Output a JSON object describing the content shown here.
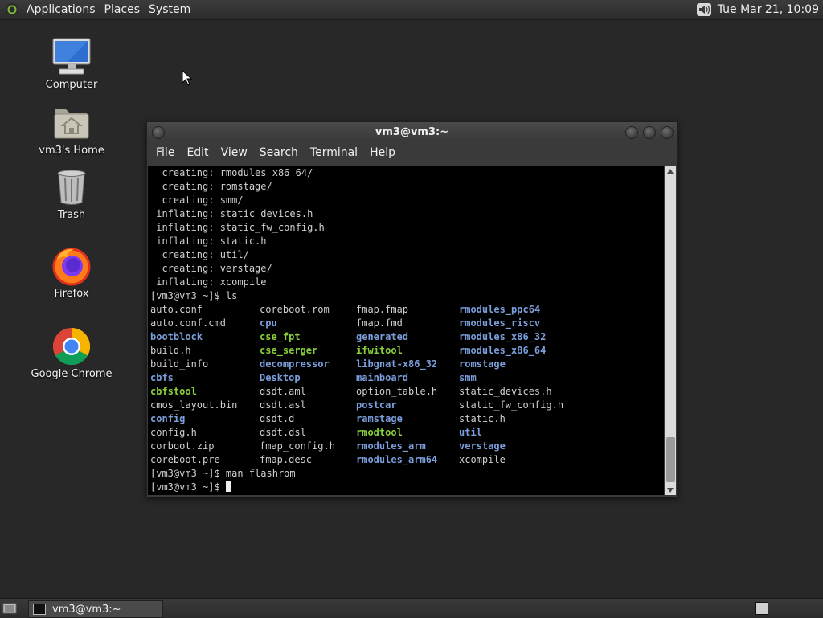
{
  "top_panel": {
    "menus": [
      "Applications",
      "Places",
      "System"
    ],
    "clock": "Tue Mar 21, 10:09"
  },
  "desktop": {
    "icons": [
      {
        "label": "Computer",
        "icon": "computer-icon"
      },
      {
        "label": "vm3's Home",
        "icon": "home-folder-icon"
      },
      {
        "label": "Trash",
        "icon": "trash-icon"
      },
      {
        "label": "Firefox",
        "icon": "firefox-icon"
      },
      {
        "label": "Google Chrome",
        "icon": "chrome-icon"
      }
    ]
  },
  "terminal": {
    "title": "vm3@vm3:~",
    "menus": [
      "File",
      "Edit",
      "View",
      "Search",
      "Terminal",
      "Help"
    ],
    "lines_before": [
      "  creating: rmodules_x86_64/",
      "  creating: romstage/",
      "  creating: smm/",
      " inflating: static_devices.h",
      " inflating: static_fw_config.h",
      " inflating: static.h",
      "  creating: util/",
      "  creating: verstage/",
      " inflating: xcompile",
      "[vm3@vm3 ~]$ ls"
    ],
    "ls_rows": [
      [
        {
          "t": "auto.conf",
          "k": "f"
        },
        {
          "t": "coreboot.rom",
          "k": "f"
        },
        {
          "t": "fmap.fmap",
          "k": "f"
        },
        {
          "t": "rmodules_ppc64",
          "k": "d"
        }
      ],
      [
        {
          "t": "auto.conf.cmd",
          "k": "f"
        },
        {
          "t": "cpu",
          "k": "d"
        },
        {
          "t": "fmap.fmd",
          "k": "f"
        },
        {
          "t": "rmodules_riscv",
          "k": "d"
        }
      ],
      [
        {
          "t": "bootblock",
          "k": "d"
        },
        {
          "t": "cse_fpt",
          "k": "x"
        },
        {
          "t": "generated",
          "k": "d"
        },
        {
          "t": "rmodules_x86_32",
          "k": "d"
        }
      ],
      [
        {
          "t": "build.h",
          "k": "f"
        },
        {
          "t": "cse_serger",
          "k": "x"
        },
        {
          "t": "ifwitool",
          "k": "x"
        },
        {
          "t": "rmodules_x86_64",
          "k": "d"
        }
      ],
      [
        {
          "t": "build_info",
          "k": "f"
        },
        {
          "t": "decompressor",
          "k": "d"
        },
        {
          "t": "libgnat-x86_32",
          "k": "d"
        },
        {
          "t": "romstage",
          "k": "d"
        }
      ],
      [
        {
          "t": "cbfs",
          "k": "d"
        },
        {
          "t": "Desktop",
          "k": "d"
        },
        {
          "t": "mainboard",
          "k": "d"
        },
        {
          "t": "smm",
          "k": "d"
        }
      ],
      [
        {
          "t": "cbfstool",
          "k": "x"
        },
        {
          "t": "dsdt.aml",
          "k": "f"
        },
        {
          "t": "option_table.h",
          "k": "f"
        },
        {
          "t": "static_devices.h",
          "k": "f"
        }
      ],
      [
        {
          "t": "cmos_layout.bin",
          "k": "f"
        },
        {
          "t": "dsdt.asl",
          "k": "f"
        },
        {
          "t": "postcar",
          "k": "d"
        },
        {
          "t": "static_fw_config.h",
          "k": "f"
        }
      ],
      [
        {
          "t": "config",
          "k": "d"
        },
        {
          "t": "dsdt.d",
          "k": "f"
        },
        {
          "t": "ramstage",
          "k": "d"
        },
        {
          "t": "static.h",
          "k": "f"
        }
      ],
      [
        {
          "t": "config.h",
          "k": "f"
        },
        {
          "t": "dsdt.dsl",
          "k": "f"
        },
        {
          "t": "rmodtool",
          "k": "x"
        },
        {
          "t": "util",
          "k": "d"
        }
      ],
      [
        {
          "t": "corboot.zip",
          "k": "f"
        },
        {
          "t": "fmap_config.h",
          "k": "f"
        },
        {
          "t": "rmodules_arm",
          "k": "d"
        },
        {
          "t": "verstage",
          "k": "d"
        }
      ],
      [
        {
          "t": "coreboot.pre",
          "k": "f"
        },
        {
          "t": "fmap.desc",
          "k": "f"
        },
        {
          "t": "rmodules_arm64",
          "k": "d"
        },
        {
          "t": "xcompile",
          "k": "f"
        }
      ]
    ],
    "lines_after": [
      "[vm3@vm3 ~]$ man flashrom"
    ],
    "prompt": "[vm3@vm3 ~]$ "
  },
  "bottom_panel": {
    "task_label": "vm3@vm3:~"
  }
}
